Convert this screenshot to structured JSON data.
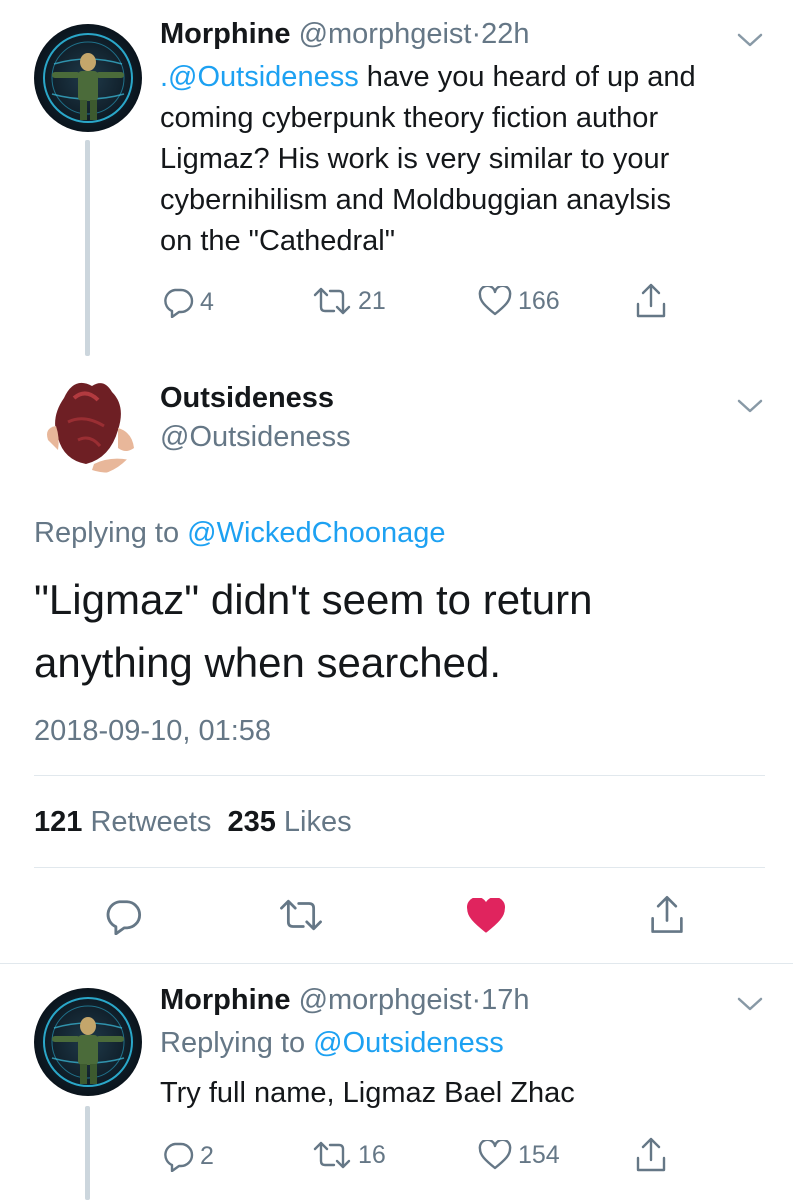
{
  "tweet1": {
    "display_name": "Morphine",
    "handle": "@morphgeist",
    "separator": "·",
    "time": "22h",
    "mention": ".@Outsideness",
    "text_line1": " have you heard of up and",
    "text_line2": "coming cyberpunk theory fiction author",
    "text_line3": "Ligmaz? His work is very similar to your",
    "text_line4": "cybernihilism and Moldbuggian anaylsis",
    "text_line5": "on the \"Cathedral\"",
    "replies": "4",
    "retweets": "21",
    "likes": "166"
  },
  "focused": {
    "display_name": "Outsideness",
    "handle": "@Outsideness",
    "replying_prefix": "Replying to",
    "replying_to": "@WickedChoonage",
    "text_line1": "\"Ligmaz\" didn't seem to return",
    "text_line2": "anything when searched.",
    "timestamp": "2018-09-10, 01:58",
    "retweet_count": "121",
    "retweet_label": "Retweets",
    "like_count": "235",
    "like_label": "Likes"
  },
  "tweet3": {
    "display_name": "Morphine",
    "handle": "@morphgeist",
    "separator": "·",
    "time": "17h",
    "replying_prefix": "Replying to",
    "replying_to": "@Outsideness",
    "text": "Try full name, Ligmaz Bael Zhac",
    "replies": "2",
    "retweets": "16",
    "likes": "154"
  },
  "icons": {
    "reply": "reply-icon",
    "retweet": "retweet-icon",
    "like": "heart-icon",
    "share": "share-icon",
    "more": "chevron-down-icon"
  },
  "colors": {
    "link_blue": "#1da1f2",
    "like_red": "#e0245e",
    "secondary_gray": "#657786",
    "thread_line": "#ccd6dd"
  }
}
